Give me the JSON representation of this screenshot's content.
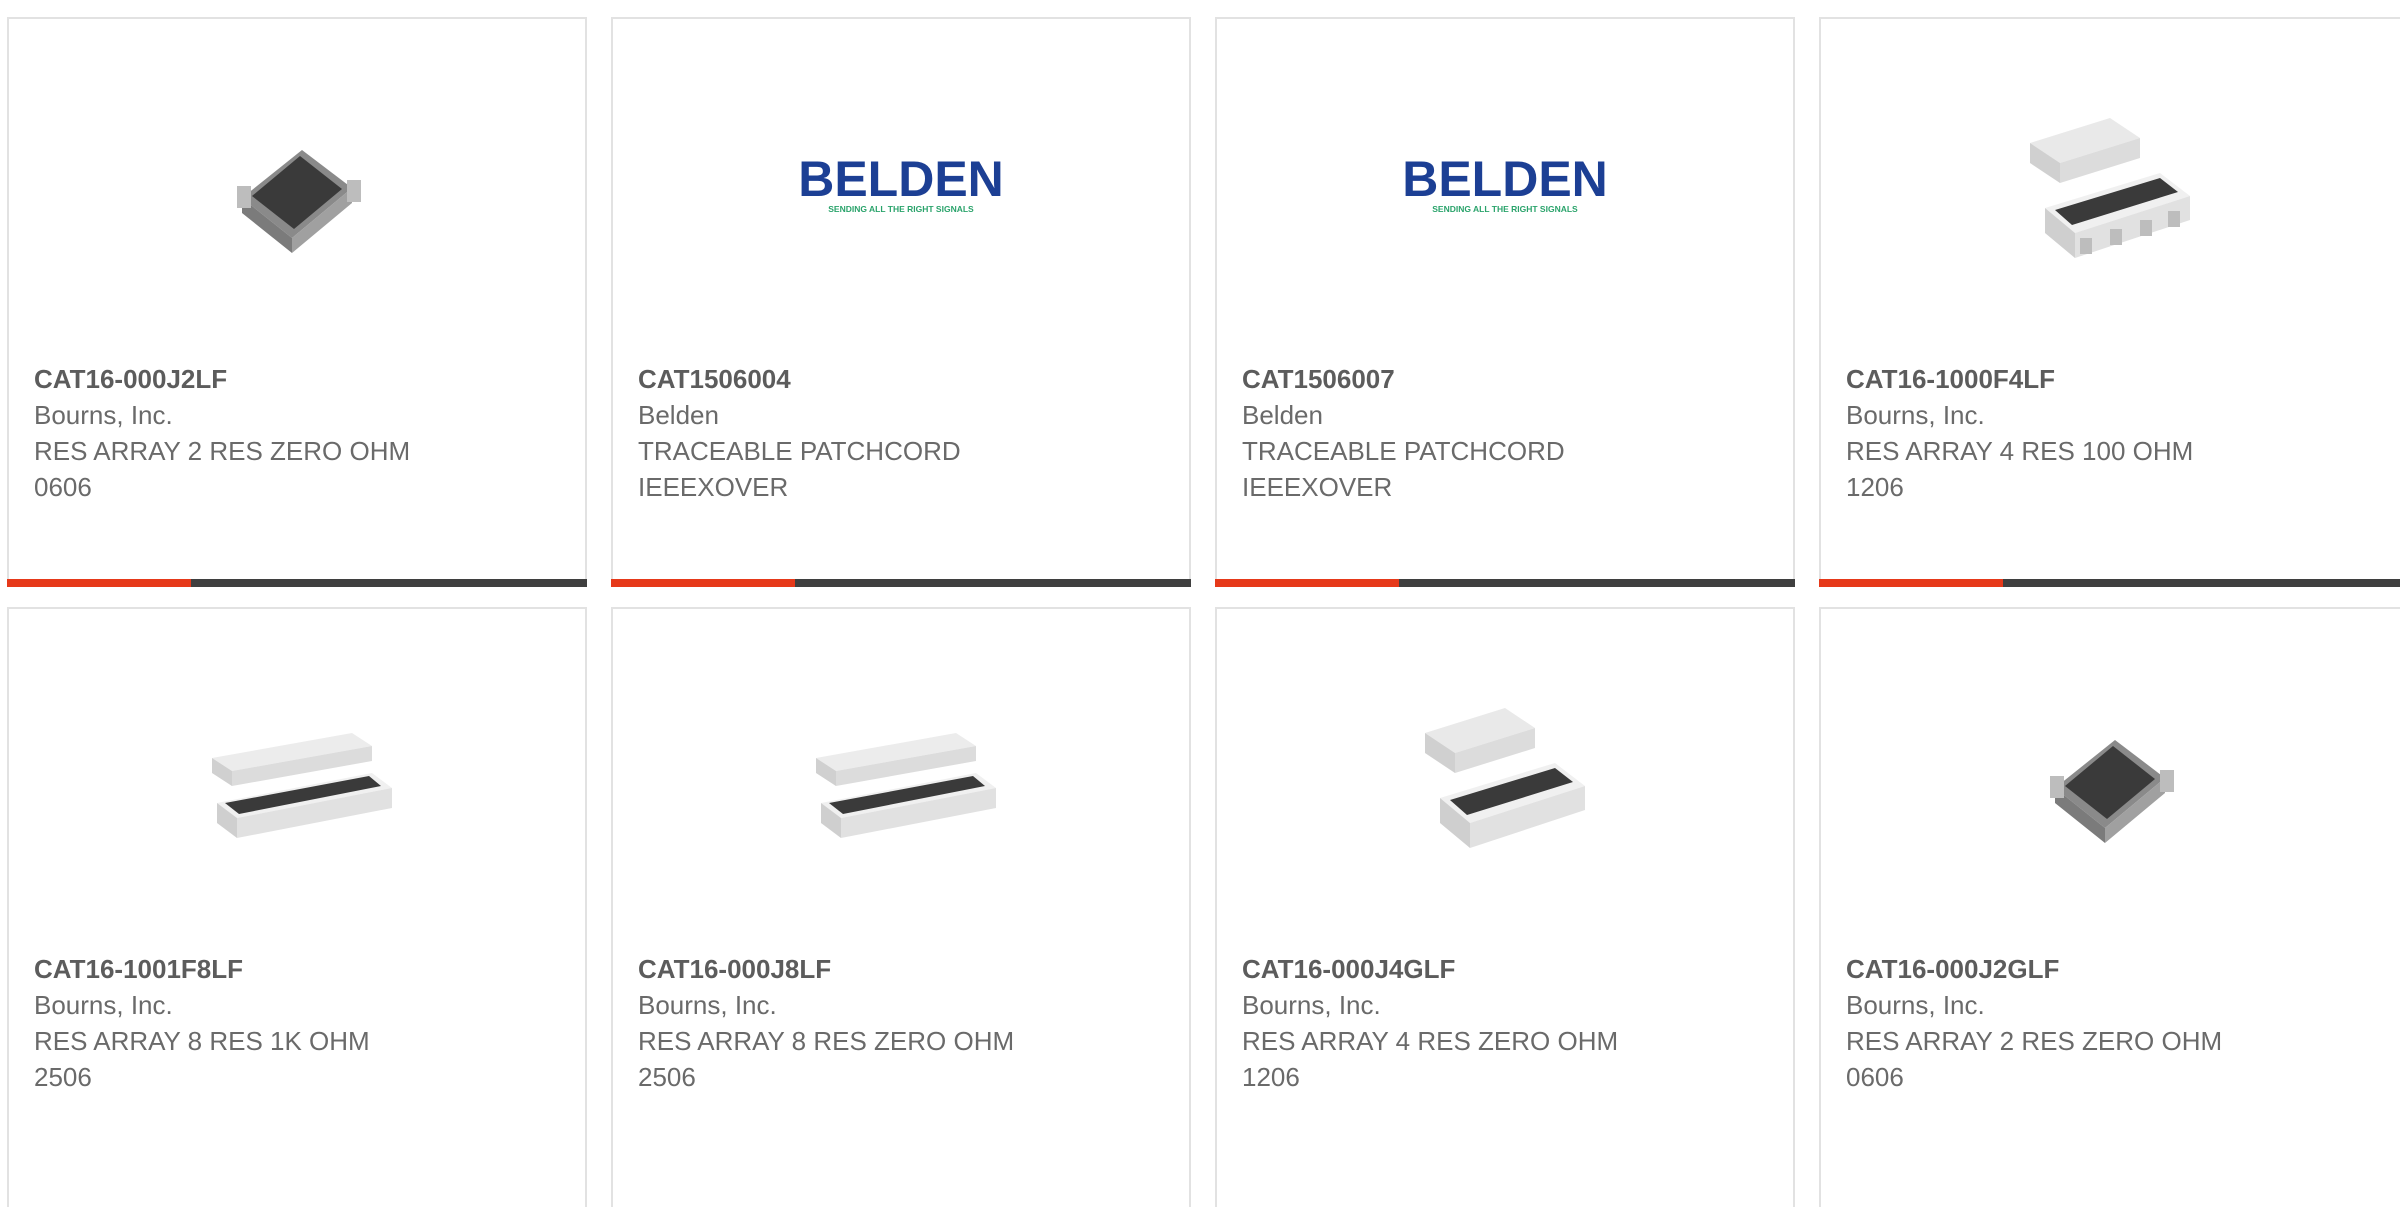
{
  "colors": {
    "accent": "#e6391a",
    "bar": "#3f3f3f",
    "border": "#e2e2e2",
    "text": "#5c5c5c"
  },
  "products": [
    {
      "part": "CAT16-000J2LF",
      "manufacturer": "Bourns, Inc.",
      "description": "RES ARRAY 2 RES ZERO OHM\n0606",
      "image": "res-array-2-image"
    },
    {
      "part": "CAT1506004",
      "manufacturer": "Belden",
      "description": "TRACEABLE PATCHCORD\nIEEEXOVER",
      "image": "belden-logo",
      "logo_text": "BELDEN",
      "logo_tagline": "SENDING ALL THE RIGHT SIGNALS"
    },
    {
      "part": "CAT1506007",
      "manufacturer": "Belden",
      "description": "TRACEABLE PATCHCORD\nIEEEXOVER",
      "image": "belden-logo",
      "logo_text": "BELDEN",
      "logo_tagline": "SENDING ALL THE RIGHT SIGNALS"
    },
    {
      "part": "CAT16-1000F4LF",
      "manufacturer": "Bourns, Inc.",
      "description": "RES ARRAY 4 RES 100 OHM\n1206",
      "image": "res-array-4-image"
    },
    {
      "part": "CAT16-1001F8LF",
      "manufacturer": "Bourns, Inc.",
      "description": "RES ARRAY 8 RES 1K OHM\n2506",
      "image": "res-array-8-image"
    },
    {
      "part": "CAT16-000J8LF",
      "manufacturer": "Bourns, Inc.",
      "description": "RES ARRAY 8 RES ZERO OHM\n2506",
      "image": "res-array-8-image"
    },
    {
      "part": "CAT16-000J4GLF",
      "manufacturer": "Bourns, Inc.",
      "description": "RES ARRAY 4 RES ZERO OHM\n1206",
      "image": "res-array-4-image"
    },
    {
      "part": "CAT16-000J2GLF",
      "manufacturer": "Bourns, Inc.",
      "description": "RES ARRAY 2 RES ZERO OHM\n0606",
      "image": "res-array-2-image"
    }
  ]
}
